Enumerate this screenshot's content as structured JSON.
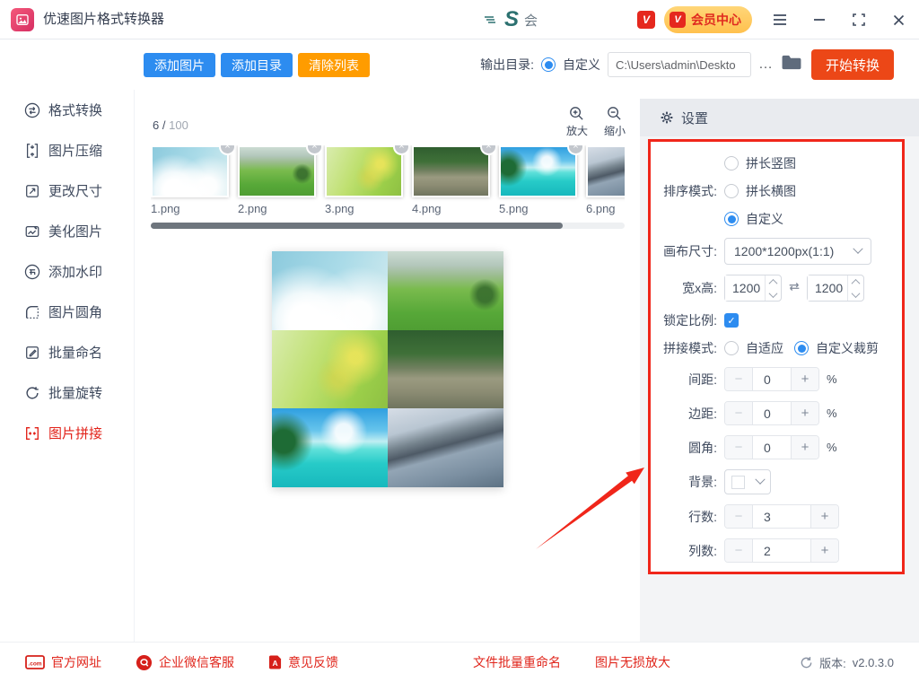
{
  "titlebar": {
    "app_title": "优速图片格式转换器",
    "logo_badge": "会",
    "vip_badge": "V",
    "member_center": "会员中心"
  },
  "toolbar": {
    "add_images": "添加图片",
    "add_folder": "添加目录",
    "clear_list": "清除列表",
    "output_label": "输出目录:",
    "output_option": "自定义",
    "output_path": "C:\\Users\\admin\\Deskto",
    "more": "…",
    "start": "开始转换"
  },
  "sidebar": {
    "items": [
      {
        "label": "格式转换"
      },
      {
        "label": "图片压缩"
      },
      {
        "label": "更改尺寸"
      },
      {
        "label": "美化图片"
      },
      {
        "label": "添加水印"
      },
      {
        "label": "图片圆角"
      },
      {
        "label": "批量命名"
      },
      {
        "label": "批量旋转"
      },
      {
        "label": "图片拼接",
        "active": true
      }
    ]
  },
  "filelist": {
    "count_current": "6",
    "count_divider": "/",
    "count_total": "100",
    "zoom_in": "放大",
    "zoom_out": "缩小",
    "close": "×",
    "files": [
      "1.png",
      "2.png",
      "3.png",
      "4.png",
      "5.png",
      "6.png"
    ]
  },
  "settings": {
    "title": "设置",
    "sort_label": "排序模式:",
    "sort_opt1": "拼长竖图",
    "sort_opt2": "拼长横图",
    "sort_opt3": "自定义",
    "canvas_label": "画布尺寸:",
    "canvas_value": "1200*1200px(1:1)",
    "wh_label": "宽x高:",
    "width_value": "1200",
    "height_value": "1200",
    "lock_label": "锁定比例:",
    "check": "✓",
    "stitch_label": "拼接模式:",
    "stitch_opt1": "自适应",
    "stitch_opt2": "自定义裁剪",
    "gap_label": "间距:",
    "gap_value": "0",
    "margin_label": "边距:",
    "margin_value": "0",
    "corner_label": "圆角:",
    "corner_value": "0",
    "percent": "%",
    "bg_label": "背景:",
    "rows_label": "行数:",
    "rows_value": "3",
    "cols_label": "列数:",
    "cols_value": "2",
    "minus": "−",
    "plus": "+"
  },
  "footer": {
    "com": ".com",
    "site": "官方网址",
    "wechat": "企业微信客服",
    "feedback": "意见反馈",
    "rename": "文件批量重命名",
    "upscale": "图片无损放大",
    "version_label": "版本:",
    "version_value": "v2.0.3.0"
  },
  "colors": {
    "accent_blue": "#2d8cf0",
    "accent_orange": "#ff9c00",
    "start_red": "#ec4717",
    "annotation_red": "#f0261a",
    "link_red": "#e0261c"
  }
}
